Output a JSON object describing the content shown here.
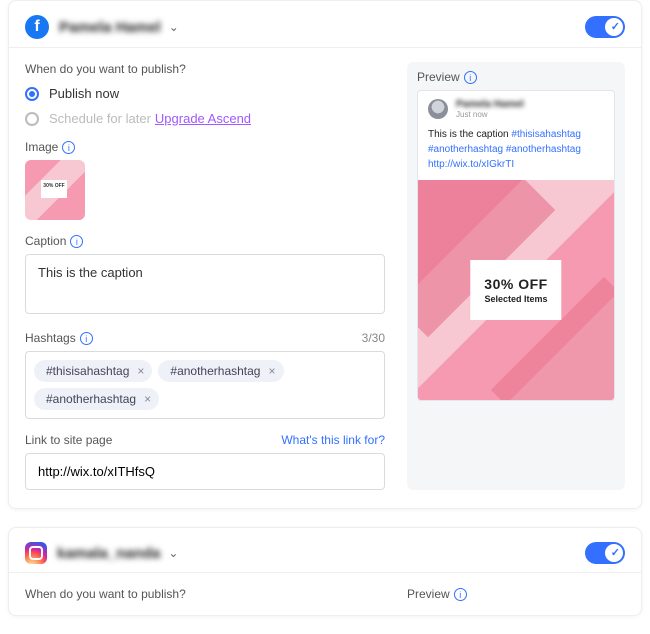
{
  "networks": [
    {
      "kind": "facebook",
      "account_name": "Pamela Hamel",
      "enabled": true,
      "publish": {
        "question": "When do you want to publish?",
        "opt_now": "Publish now",
        "opt_later": "Schedule for later",
        "upgrade": "Upgrade Ascend",
        "selected": "now"
      },
      "sections": {
        "image": "Image",
        "caption": "Caption",
        "hashtags": "Hashtags",
        "link": "Link to site page",
        "preview": "Preview",
        "link_help": "What's this link for?"
      },
      "caption_value": "This is the caption",
      "hashtags": {
        "count": "3/30",
        "items": [
          "#thisisahashtag",
          "#anotherhashtag",
          "#anotherhashtag"
        ]
      },
      "link_value": "http://wix.to/xITHfsQ",
      "preview": {
        "account_name": "Pamela Hamel",
        "subtitle": "Just now",
        "caption": "This is the caption",
        "tags": "#thisisahashtag #anotherhashtag #anotherhashtag",
        "link": "http://wix.to/xIGkrTI",
        "promo_big": "30% OFF",
        "promo_small": "Selected Items"
      }
    },
    {
      "kind": "instagram",
      "account_name": "kamala_nanda",
      "enabled": true,
      "publish": {
        "question": "When do you want to publish?"
      },
      "sections": {
        "preview": "Preview"
      }
    }
  ]
}
